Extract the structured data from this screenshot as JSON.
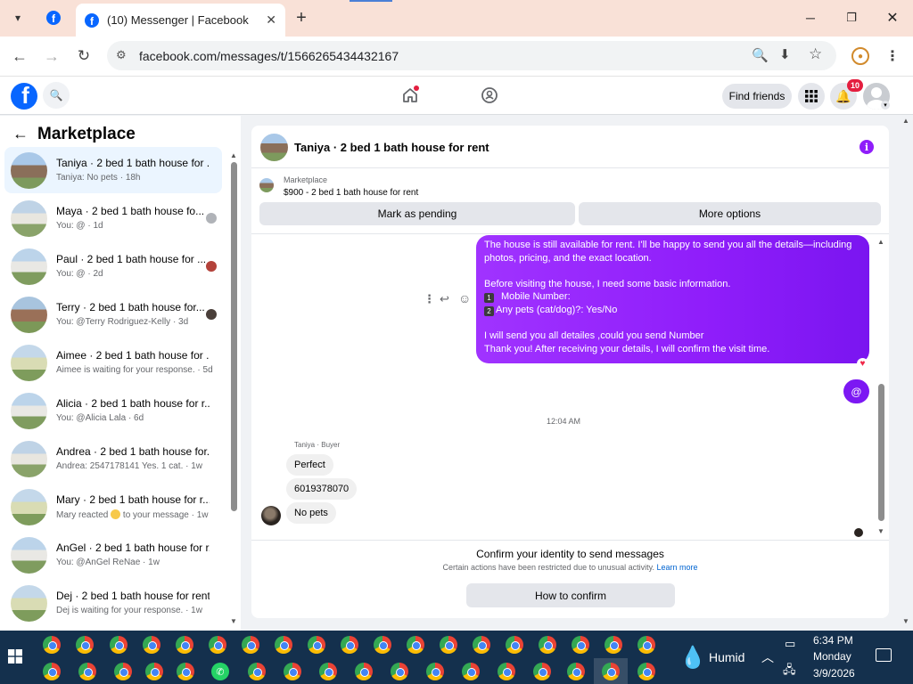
{
  "browser": {
    "tab_title": "(10) Messenger | Facebook",
    "url": "facebook.com/messages/t/1566265434432167"
  },
  "fb": {
    "notif_count": "10",
    "find_friends": "Find friends"
  },
  "sidebar": {
    "title": "Marketplace",
    "items": [
      {
        "title": "Taniya · 2 bed 1 bath house for ...",
        "subtitle": "Taniya: No pets · 18h"
      },
      {
        "title": "Maya · 2 bed 1 bath house fo...",
        "subtitle": "You: @ · 1d"
      },
      {
        "title": "Paul · 2 bed 1 bath house for ...",
        "subtitle": "You: @ · 2d"
      },
      {
        "title": "Terry · 2 bed 1 bath house for...",
        "subtitle": "You: @Terry Rodriguez-Kelly · 3d"
      },
      {
        "title": "Aimee · 2 bed 1 bath house for ...",
        "subtitle": "Aimee is waiting for your response. · 5d"
      },
      {
        "title": "Alicia · 2 bed 1 bath house for r...",
        "subtitle": "You: @Alicia Lala · 6d"
      },
      {
        "title": "Andrea · 2 bed 1 bath house for...",
        "subtitle": "Andrea: 2547178141 Yes. 1 cat. · 1w"
      },
      {
        "title": "Mary · 2 bed 1 bath house for r...",
        "subtitle_pre": "Mary reacted",
        "subtitle_post": "to your message · 1w"
      },
      {
        "title": "AnGel · 2 bed 1 bath house for r...",
        "subtitle": "You: @AnGel ReNae · 1w"
      },
      {
        "title": "Dej · 2 bed 1 bath house for rent",
        "subtitle": "Dej is waiting for your response. · 1w"
      }
    ]
  },
  "chat": {
    "header_title": "Taniya · 2 bed 1 bath house for rent",
    "listing_source": "Marketplace",
    "listing_title": "$900 - 2 bed 1 bath house for rent",
    "mark_pending": "Mark as pending",
    "more_options": "More options",
    "outgoing": {
      "l1": "The house is still available for rent. I'll be happy to send you all the details—including",
      "l2": "photos, pricing, and the exact location.",
      "l3": "Before visiting the house, I need some basic information.",
      "l4": "Mobile Number:",
      "l5": "Any pets (cat/dog)?: Yes/No",
      "l6": "I will send you all detailes ,could you send Number",
      "l7": "Thank you! After receiving your details, I will confirm the visit time.",
      "num1": "1",
      "num2": "2"
    },
    "at_symbol": "@",
    "timestamp": "12:04 AM",
    "sender_label": "Taniya · Buyer",
    "incoming": [
      "Perfect",
      "6019378070",
      "No pets"
    ],
    "confirm_title": "Confirm your identity to send messages",
    "confirm_desc": "Certain actions have been restricted due to unusual activity.",
    "learn_more": "Learn more",
    "how_to_confirm": "How to confirm"
  },
  "taskbar": {
    "weather": "Humid",
    "time": "6:34 PM",
    "day": "Monday",
    "date": "3/9/2026"
  },
  "colors": {
    "fb_blue": "#0866ff",
    "bubble_purple": "#8f1dfa",
    "tab_bg": "#f9e1d7",
    "taskbar": "#14304d"
  }
}
